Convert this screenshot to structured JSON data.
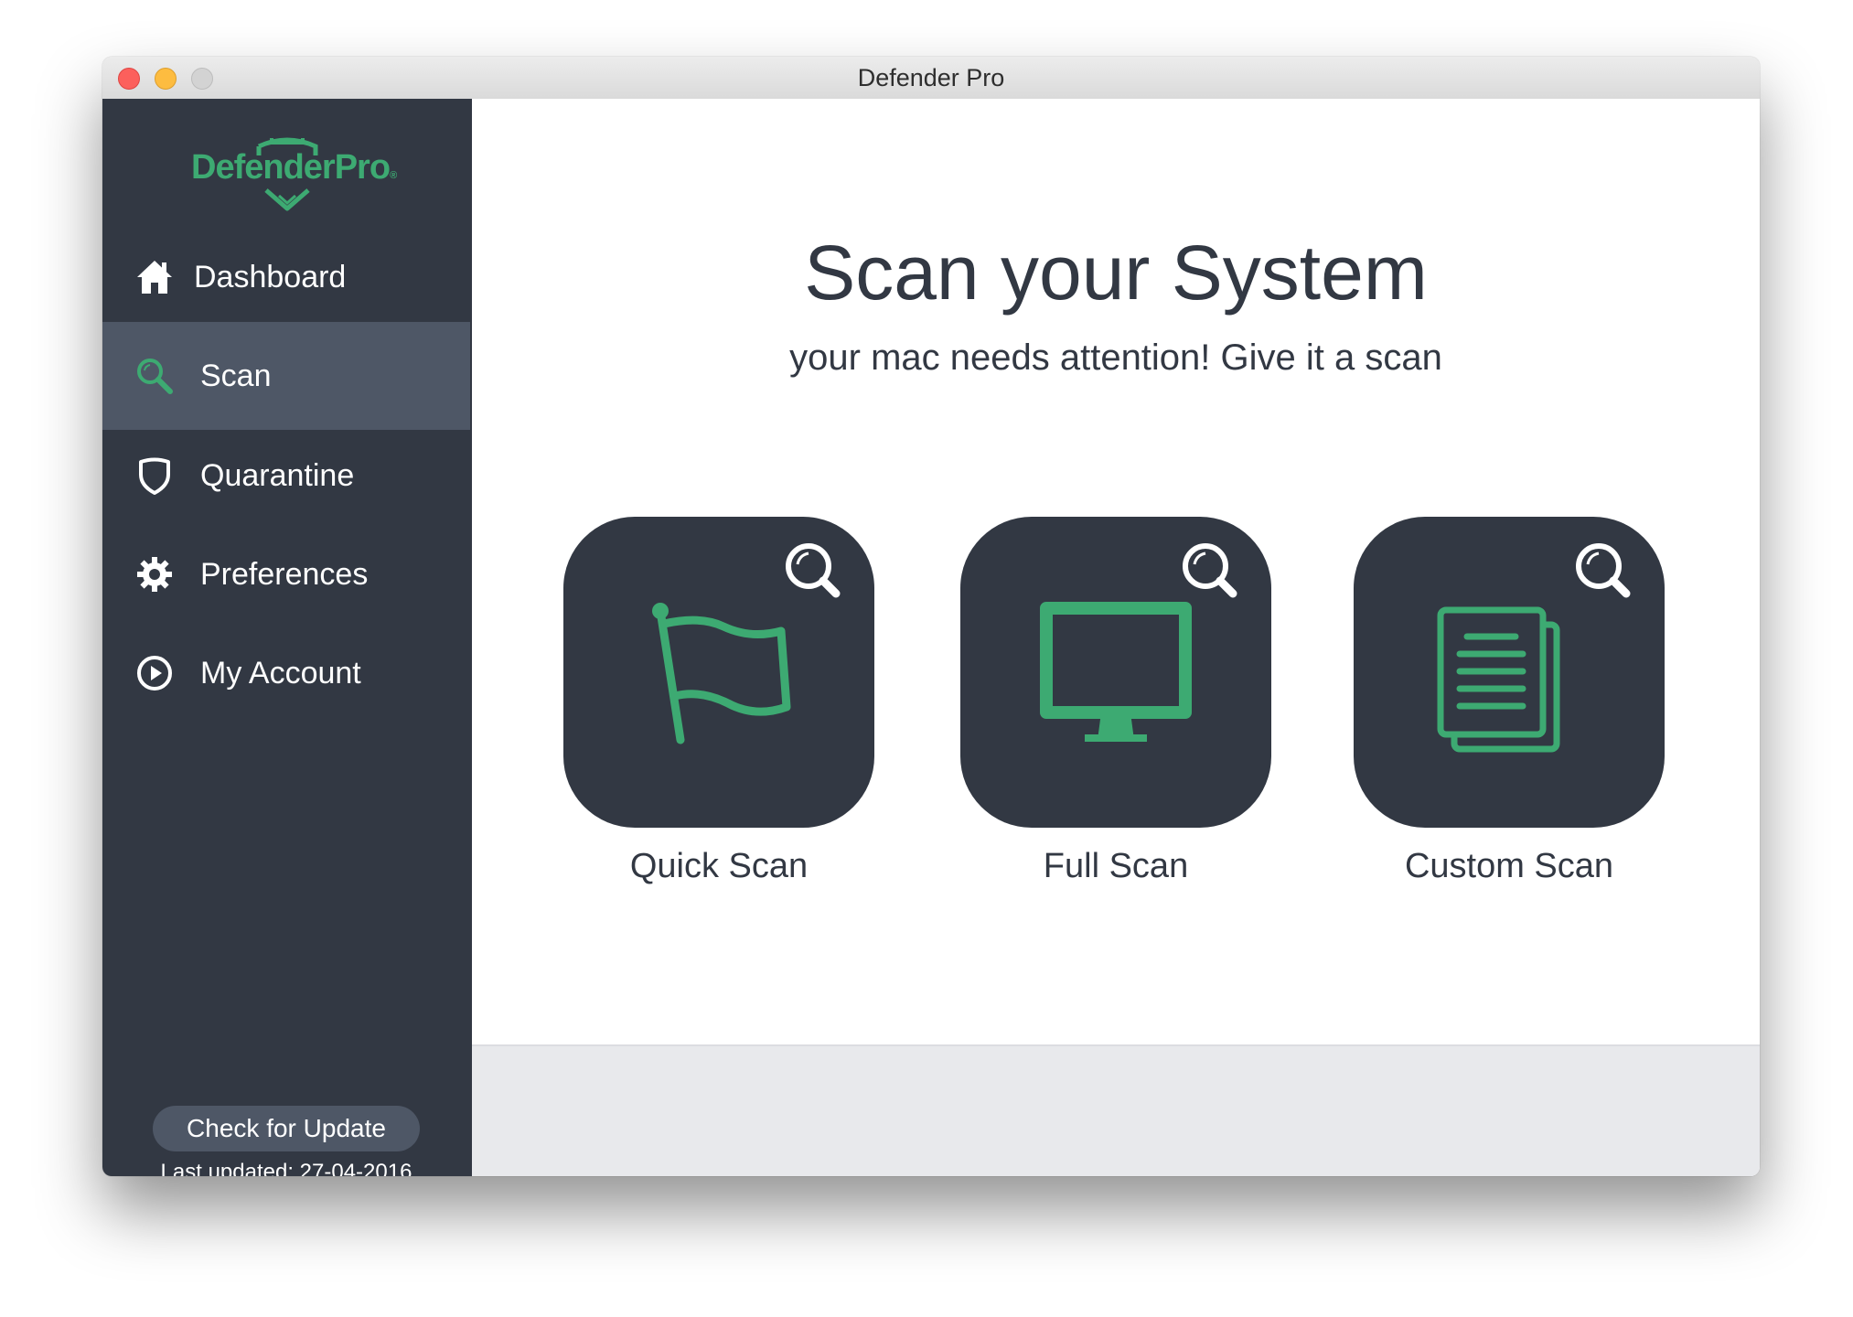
{
  "window": {
    "title": "Defender Pro"
  },
  "colors": {
    "sidebar_bg": "#323843",
    "sidebar_active": "#4e5766",
    "accent_green": "#3daa72",
    "card_bg": "#323843",
    "text_dark": "#323843"
  },
  "sidebar": {
    "logo_text": "DefenderPro",
    "items": [
      {
        "label": "Dashboard",
        "icon": "home-icon",
        "active": false
      },
      {
        "label": "Scan",
        "icon": "search-icon",
        "active": true
      },
      {
        "label": "Quarantine",
        "icon": "shield-icon",
        "active": false
      },
      {
        "label": "Preferences",
        "icon": "gear-icon",
        "active": false
      },
      {
        "label": "My Account",
        "icon": "play-circle-icon",
        "active": false
      }
    ],
    "update_button_label": "Check for Update",
    "last_updated": "Last updated: 27-04-2016"
  },
  "main": {
    "title": "Scan your System",
    "subtitle": "your mac needs attention! Give it a scan",
    "scan_options": [
      {
        "label": "Quick Scan",
        "icon": "flag-icon"
      },
      {
        "label": "Full Scan",
        "icon": "monitor-icon"
      },
      {
        "label": "Custom Scan",
        "icon": "documents-icon"
      }
    ]
  }
}
